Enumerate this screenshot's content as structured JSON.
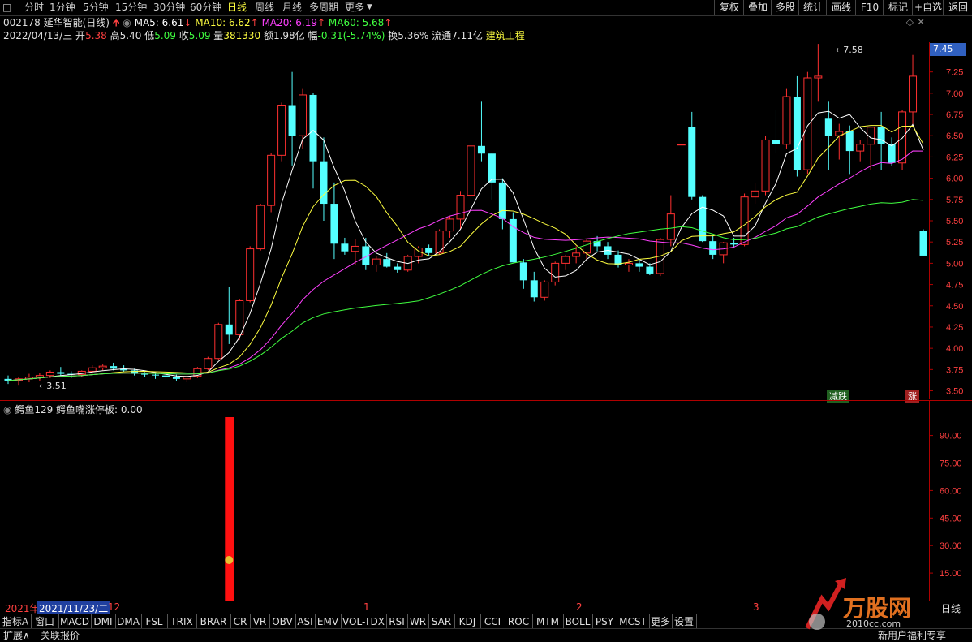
{
  "topbar": {
    "period_buttons": [
      "分时",
      "1分钟",
      "5分钟",
      "15分钟",
      "30分钟",
      "60分钟",
      "日线",
      "周线",
      "月线",
      "多周期",
      "更多"
    ],
    "right_buttons": [
      "复权",
      "叠加",
      "多股",
      "统计",
      "画线",
      "F10",
      "标记",
      "+自选",
      "返回"
    ]
  },
  "info1": {
    "code_name": "002178 延华智能(日线)",
    "ma5": "MA5: 6.61",
    "ma10": "MA10: 6.62",
    "ma20": "MA20: 6.19",
    "ma60": "MA60: 5.68"
  },
  "info2": {
    "date": "2022/04/13/三",
    "open_l": "开",
    "open": "5.38",
    "high_l": "高",
    "high": "5.40",
    "low_l": "低",
    "low": "5.09",
    "close_l": "收",
    "close": "5.09",
    "vol_l": "量",
    "vol": "381330",
    "amt_l": "额",
    "amt": "1.98亿",
    "chg_l": "幅",
    "chg": "-0.31(-5.74%)",
    "turn_l": "换",
    "turn": "5.36%",
    "float_l": "流通",
    "float": "7.11亿",
    "sector": "建筑工程"
  },
  "price_axis": {
    "current": "7.45",
    "ticks": [
      "7.25",
      "7.00",
      "6.75",
      "6.50",
      "6.25",
      "6.00",
      "5.75",
      "5.50",
      "5.25",
      "5.00",
      "4.75",
      "4.50",
      "4.25",
      "4.00",
      "3.75",
      "3.50"
    ]
  },
  "annotations": {
    "high": "7.58",
    "low": "3.51",
    "tag_decline": "减跌",
    "tag_rise": "涨"
  },
  "indicator": {
    "name": "鳄鱼129",
    "title": "鳄鱼嘴涨停板:",
    "value": "0.00",
    "ticks": [
      "90.00",
      "75.00",
      "60.00",
      "45.00",
      "30.00",
      "15.00"
    ]
  },
  "timeaxis": {
    "year": "2021年",
    "cursor_date": "2021/11/23/二",
    "m12": "12",
    "m1": "1",
    "m2": "2",
    "m3": "3",
    "right": "日线"
  },
  "bottombar": {
    "indicators": [
      "指标A",
      "窗口",
      "MACD",
      "DMI",
      "DMA",
      "FSL",
      "TRIX",
      "BRAR",
      "CR",
      "VR",
      "OBV",
      "ASI",
      "EMV",
      "VOL-TDX",
      "RSI",
      "WR",
      "SAR",
      "KDJ",
      "CCI",
      "ROC",
      "MTM",
      "BOLL",
      "PSY",
      "MCST",
      "更多",
      "设置"
    ]
  },
  "bottombar2": {
    "expand": "扩展∧",
    "link": "关联报价",
    "promo": "新用户福利专享",
    "watermark": "万股网",
    "watermark_url": "2010cc.com"
  },
  "chart_data": [
    {
      "type": "candlestick",
      "title": "002178 延华智能(日线)",
      "ylim": [
        3.4,
        7.6
      ],
      "ohlc": [
        [
          3.64,
          3.68,
          3.58,
          3.62
        ],
        [
          3.62,
          3.66,
          3.57,
          3.64
        ],
        [
          3.64,
          3.7,
          3.6,
          3.66
        ],
        [
          3.66,
          3.71,
          3.62,
          3.68
        ],
        [
          3.68,
          3.74,
          3.65,
          3.72
        ],
        [
          3.72,
          3.78,
          3.68,
          3.7
        ],
        [
          3.7,
          3.73,
          3.65,
          3.69
        ],
        [
          3.69,
          3.74,
          3.66,
          3.73
        ],
        [
          3.73,
          3.8,
          3.7,
          3.77
        ],
        [
          3.77,
          3.81,
          3.74,
          3.79
        ],
        [
          3.79,
          3.83,
          3.74,
          3.76
        ],
        [
          3.76,
          3.8,
          3.72,
          3.74
        ],
        [
          3.74,
          3.76,
          3.68,
          3.7
        ],
        [
          3.7,
          3.72,
          3.66,
          3.69
        ],
        [
          3.69,
          3.71,
          3.64,
          3.68
        ],
        [
          3.68,
          3.7,
          3.63,
          3.66
        ],
        [
          3.66,
          3.69,
          3.62,
          3.64
        ],
        [
          3.64,
          3.68,
          3.6,
          3.67
        ],
        [
          3.67,
          3.78,
          3.65,
          3.76
        ],
        [
          3.76,
          3.9,
          3.74,
          3.88
        ],
        [
          3.88,
          4.3,
          3.86,
          4.28
        ],
        [
          4.28,
          4.72,
          4.05,
          4.16
        ],
        [
          4.16,
          4.58,
          4.1,
          4.56
        ],
        [
          4.56,
          5.2,
          4.54,
          5.17
        ],
        [
          5.17,
          5.7,
          5.15,
          5.68
        ],
        [
          5.68,
          6.3,
          5.6,
          6.27
        ],
        [
          6.27,
          6.89,
          6.2,
          6.86
        ],
        [
          6.86,
          7.25,
          6.15,
          6.5
        ],
        [
          6.5,
          7.05,
          6.35,
          6.98
        ],
        [
          6.98,
          7.0,
          5.88,
          6.2
        ],
        [
          6.2,
          6.48,
          5.5,
          5.7
        ],
        [
          5.7,
          5.95,
          5.05,
          5.23
        ],
        [
          5.23,
          5.3,
          5.1,
          5.14
        ],
        [
          5.14,
          5.28,
          4.98,
          5.2
        ],
        [
          5.2,
          5.3,
          4.92,
          4.98
        ],
        [
          4.98,
          5.08,
          4.9,
          5.05
        ],
        [
          5.05,
          5.12,
          4.95,
          4.96
        ],
        [
          4.96,
          5.0,
          4.89,
          4.92
        ],
        [
          4.92,
          5.1,
          4.9,
          5.08
        ],
        [
          5.08,
          5.2,
          5.0,
          5.18
        ],
        [
          5.18,
          5.22,
          5.08,
          5.12
        ],
        [
          5.12,
          5.4,
          5.1,
          5.38
        ],
        [
          5.38,
          5.55,
          5.3,
          5.52
        ],
        [
          5.52,
          5.85,
          5.4,
          5.8
        ],
        [
          5.8,
          6.4,
          5.6,
          6.38
        ],
        [
          6.38,
          6.9,
          6.2,
          6.29
        ],
        [
          6.29,
          6.3,
          5.75,
          5.95
        ],
        [
          5.95,
          6.0,
          5.4,
          5.52
        ],
        [
          5.52,
          5.6,
          5.1,
          5.01
        ],
        [
          5.01,
          5.05,
          4.7,
          4.8
        ],
        [
          4.8,
          4.9,
          4.55,
          4.6
        ],
        [
          4.6,
          4.8,
          4.56,
          4.78
        ],
        [
          4.78,
          5.02,
          4.74,
          5.0
        ],
        [
          5.0,
          5.1,
          4.92,
          5.08
        ],
        [
          5.08,
          5.2,
          5.0,
          5.12
        ],
        [
          5.12,
          5.28,
          5.05,
          5.26
        ],
        [
          5.26,
          5.32,
          5.14,
          5.2
        ],
        [
          5.2,
          5.25,
          5.05,
          5.1
        ],
        [
          5.1,
          5.15,
          4.95,
          4.98
        ],
        [
          4.98,
          5.05,
          4.9,
          5.0
        ],
        [
          5.0,
          5.05,
          4.9,
          4.96
        ],
        [
          4.96,
          5.0,
          4.86,
          4.88
        ],
        [
          4.88,
          5.3,
          4.85,
          5.28
        ],
        [
          5.28,
          5.8,
          5.2,
          5.58
        ],
        [
          6.4,
          6.4,
          6.4,
          6.4
        ],
        [
          6.6,
          6.78,
          5.75,
          5.78
        ],
        [
          5.78,
          5.8,
          5.25,
          5.26
        ],
        [
          5.26,
          5.32,
          5.05,
          5.1
        ],
        [
          5.1,
          5.25,
          5.0,
          5.24
        ],
        [
          5.24,
          5.3,
          5.18,
          5.22
        ],
        [
          5.22,
          5.82,
          5.2,
          5.78
        ],
        [
          5.78,
          5.95,
          5.7,
          5.85
        ],
        [
          5.85,
          6.5,
          5.8,
          6.45
        ],
        [
          6.45,
          6.8,
          6.3,
          6.4
        ],
        [
          6.4,
          7.05,
          6.35,
          6.96
        ],
        [
          6.96,
          7.2,
          6.02,
          6.1
        ],
        [
          6.1,
          7.25,
          6.05,
          7.18
        ],
        [
          7.18,
          7.58,
          6.9,
          7.2
        ],
        [
          6.7,
          6.9,
          6.1,
          6.5
        ],
        [
          6.5,
          6.64,
          6.22,
          6.55
        ],
        [
          6.55,
          6.62,
          6.05,
          6.32
        ],
        [
          6.32,
          6.45,
          6.2,
          6.4
        ],
        [
          6.4,
          6.55,
          6.1,
          6.6
        ],
        [
          6.6,
          6.78,
          6.1,
          6.4
        ],
        [
          6.4,
          6.48,
          6.15,
          6.18
        ],
        [
          6.18,
          6.8,
          6.1,
          6.78
        ],
        [
          6.78,
          7.45,
          6.6,
          7.2
        ],
        [
          5.38,
          5.4,
          5.09,
          5.09
        ]
      ]
    },
    {
      "type": "bar",
      "title": "鳄鱼嘴涨停板",
      "ylim": [
        0,
        100
      ],
      "bars": [
        {
          "index": 21,
          "value": 100
        }
      ]
    }
  ]
}
